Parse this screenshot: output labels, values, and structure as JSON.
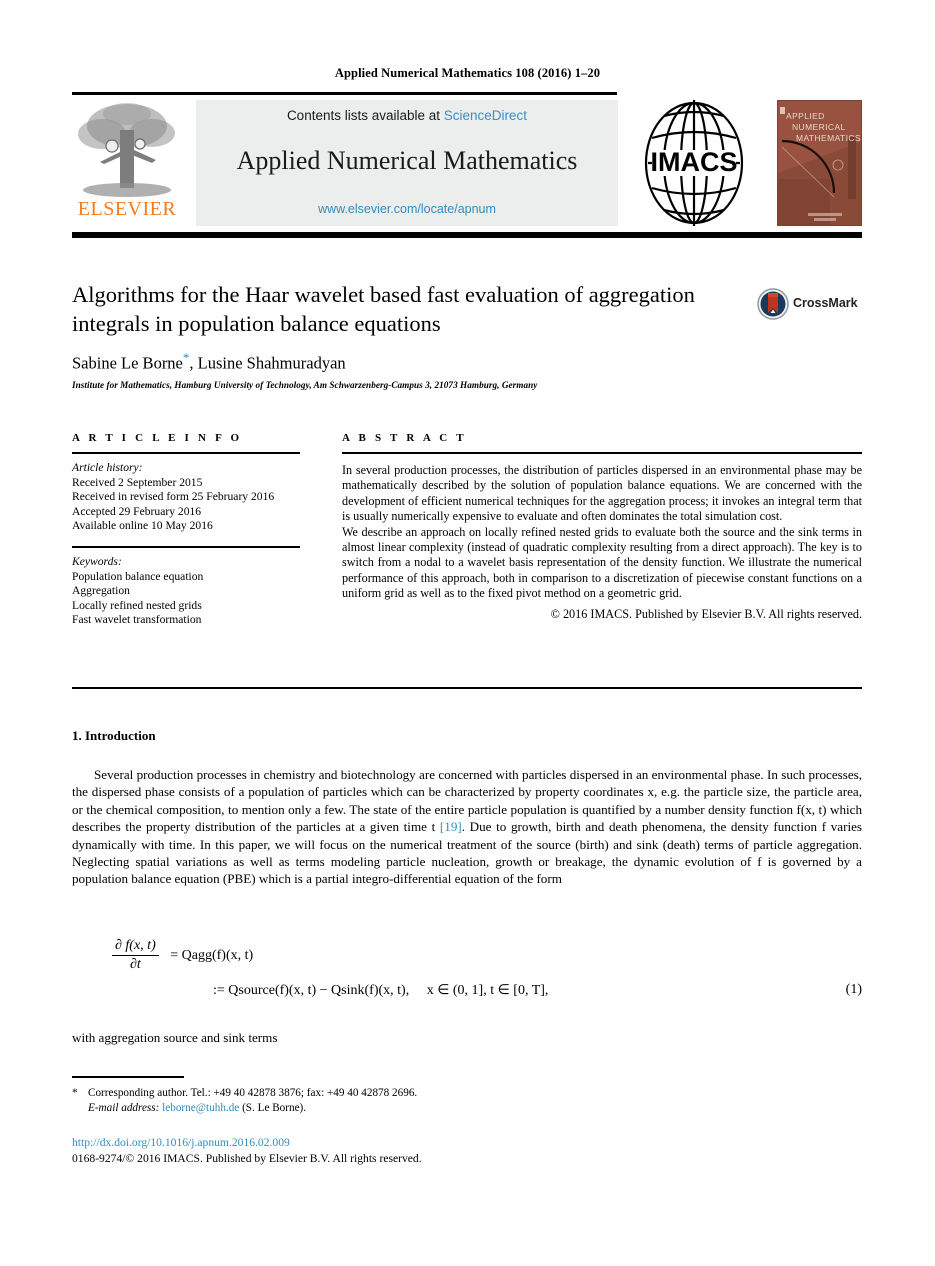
{
  "running_head": "Applied Numerical Mathematics 108 (2016) 1–20",
  "masthead": {
    "elsevier_wordmark": "ELSEVIER",
    "elsevier_logo_icon": "elsevier-tree-logo",
    "contents_prefix": "Contents lists available at ",
    "sciencedirect_link": "ScienceDirect",
    "journal_name": "Applied Numerical Mathematics",
    "journal_url": "www.elsevier.com/locate/apnum",
    "imacs_logo_icon": "imacs-globe-logo",
    "imacs_label": "IMACS",
    "cover": {
      "line1": "Applied",
      "line2": "Numerical",
      "line3": "Mathematics",
      "icon": "journal-cover-thumbnail"
    }
  },
  "article": {
    "title": "Algorithms for the Haar wavelet based fast evaluation of aggregation integrals in population balance equations",
    "crossmark_label": "CrossMark",
    "crossmark_icon": "crossmark-badge-icon",
    "authors_part1": "Sabine Le Borne",
    "authors_marker": "*",
    "authors_part2": ", Lusine Shahmuradyan",
    "affiliation": "Institute for Mathematics, Hamburg University of Technology, Am Schwarzenberg-Campus 3, 21073 Hamburg, Germany"
  },
  "article_info": {
    "heading": "A R T I C L E   I N F O",
    "history_label": "Article history:",
    "history": [
      "Received 2 September 2015",
      "Received in revised form 25 February 2016",
      "Accepted 29 February 2016",
      "Available online 10 May 2016"
    ],
    "keywords_label": "Keywords:",
    "keywords": [
      "Population balance equation",
      "Aggregation",
      "Locally refined nested grids",
      "Fast wavelet transformation"
    ]
  },
  "abstract": {
    "heading": "A B S T R A C T",
    "paragraphs": [
      "In several production processes, the distribution of particles dispersed in an environmental phase may be mathematically described by the solution of population balance equations. We are concerned with the development of efficient numerical techniques for the aggregation process; it invokes an integral term that is usually numerically expensive to evaluate and often dominates the total simulation cost.",
      "We describe an approach on locally refined nested grids to evaluate both the source and the sink terms in almost linear complexity (instead of quadratic complexity resulting from a direct approach). The key is to switch from a nodal to a wavelet basis representation of the density function. We illustrate the numerical performance of this approach, both in comparison to a discretization of piecewise constant functions on a uniform grid as well as to the fixed pivot method on a geometric grid."
    ],
    "copyright": "© 2016 IMACS. Published by Elsevier B.V. All rights reserved."
  },
  "body": {
    "section_number_title": "1. Introduction",
    "paragraph_before_ref": "Several production processes in chemistry and biotechnology are concerned with particles dispersed in an environmental phase. In such processes, the dispersed phase consists of a population of particles which can be characterized by property coordinates x, e.g. the particle size, the particle area, or the chemical composition, to mention only a few. The state of the entire particle population is quantified by a number density function f(x, t) which describes the property distribution of the particles at a given time t ",
    "reference_link": "[19]",
    "paragraph_after_ref": ". Due to growth, birth and death phenomena, the density function f varies dynamically with time. In this paper, we will focus on the numerical treatment of the source (birth) and sink (death) terms of particle aggregation. Neglecting spatial variations as well as terms modeling particle nucleation, growth or breakage, the dynamic evolution of f is governed by a population balance equation (PBE) which is a partial integro-differential equation of the form",
    "after_equation": "with aggregation source and sink terms"
  },
  "equation": {
    "numerator": "∂ f(x, t)",
    "denominator": "∂t",
    "rhs_line1_eq": "=",
    "rhs_line1_body": "Qagg(f)(x, t)",
    "line2_assign": ":=",
    "line2_body": "Qsource(f)(x, t) − Qsink(f)(x, t),",
    "line2_domain": "x ∈ (0, 1], t ∈ [0, T],",
    "number": "(1)"
  },
  "footnote": {
    "star": "*",
    "corresponding": "Corresponding author. Tel.: +49 40 42878 3876; fax: +49 40 42878 2696.",
    "email_label": "E-mail address:",
    "email": "leborne@tuhh.de",
    "email_suffix": "(S. Le Borne).",
    "doi": "http://dx.doi.org/10.1016/j.apnum.2016.02.009",
    "issn_line": "0168-9274/© 2016 IMACS. Published by Elsevier B.V. All rights reserved."
  },
  "colors": {
    "link_blue": "#2e8fc0",
    "sciencedirect_blue": "#3b8fc4",
    "elsevier_orange": "#F47C20",
    "cover_maroon": "#7a4334",
    "band_gray": "#eceded"
  }
}
